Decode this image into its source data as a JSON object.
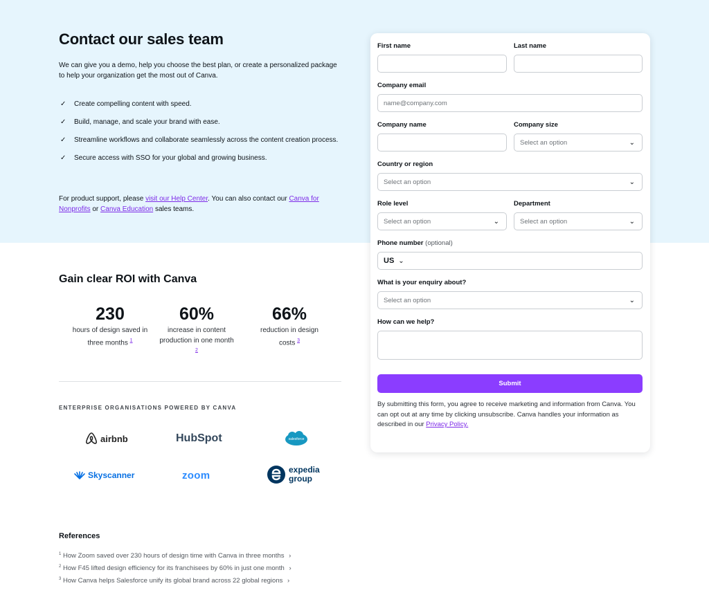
{
  "hero": {
    "title": "Contact our sales team",
    "intro": "We can give you a demo, help you choose the best plan, or create a personalized package to help your organization get the most out of Canva.",
    "benefits": [
      "Create compelling content with speed.",
      "Build, manage, and scale your brand with ease.",
      "Streamline workflows and collaborate seamlessly across the content creation process.",
      "Secure access with SSO for your global and growing business."
    ],
    "check_icon": "✓",
    "support": {
      "prefix": "For product support, please ",
      "help_link": "visit our Help Center",
      "middle": ". You can also contact our ",
      "nonprofit_link": "Canva for Nonprofits",
      "or": " or ",
      "education_link": "Canva Education",
      "suffix": " sales teams."
    }
  },
  "roi": {
    "title": "Gain clear ROI with Canva",
    "stats": [
      {
        "value": "230",
        "label": "hours of design saved in three months",
        "ref": "1"
      },
      {
        "value": "60%",
        "label": "increase in content production in one month",
        "ref": "2"
      },
      {
        "value": "66%",
        "label": "reduction in design costs",
        "ref": "3"
      }
    ]
  },
  "enterprise": {
    "title": "ENTERPRISE ORGANISATIONS POWERED BY CANVA",
    "logos": [
      "airbnb",
      "HubSpot",
      "salesforce",
      "Skyscanner",
      "zoom",
      "expedia group"
    ]
  },
  "references": {
    "title": "References",
    "items": [
      {
        "num": "1",
        "text": "How Zoom saved over 230 hours of design time with Canva in three months"
      },
      {
        "num": "2",
        "text": "How F45 lifted design efficiency for its franchisees by 60% in just one month"
      },
      {
        "num": "3",
        "text": "How Canva helps Salesforce unify its global brand across 22 global regions"
      }
    ],
    "chevron": "›"
  },
  "form": {
    "first_name_label": "First name",
    "last_name_label": "Last name",
    "email_label": "Company email",
    "email_placeholder": "name@company.com",
    "company_name_label": "Company name",
    "company_size_label": "Company size",
    "country_label": "Country or region",
    "role_label": "Role level",
    "department_label": "Department",
    "phone_label": "Phone number",
    "phone_optional": " (optional)",
    "phone_country": "US",
    "enquiry_label": "What is your enquiry about?",
    "help_label": "How can we help?",
    "select_placeholder": "Select an option",
    "chevron": "⌄",
    "submit_label": "Submit",
    "disclaimer_text": "By submitting this form, you agree to receive marketing and information from Canva. You can opt out at any time by clicking unsubscribe. Canva handles your information as described in our ",
    "privacy_link": "Privacy Policy."
  },
  "colors": {
    "accent": "#8b3dff",
    "link": "#7d2ae8",
    "hero_bg": "#e6f5fd"
  }
}
